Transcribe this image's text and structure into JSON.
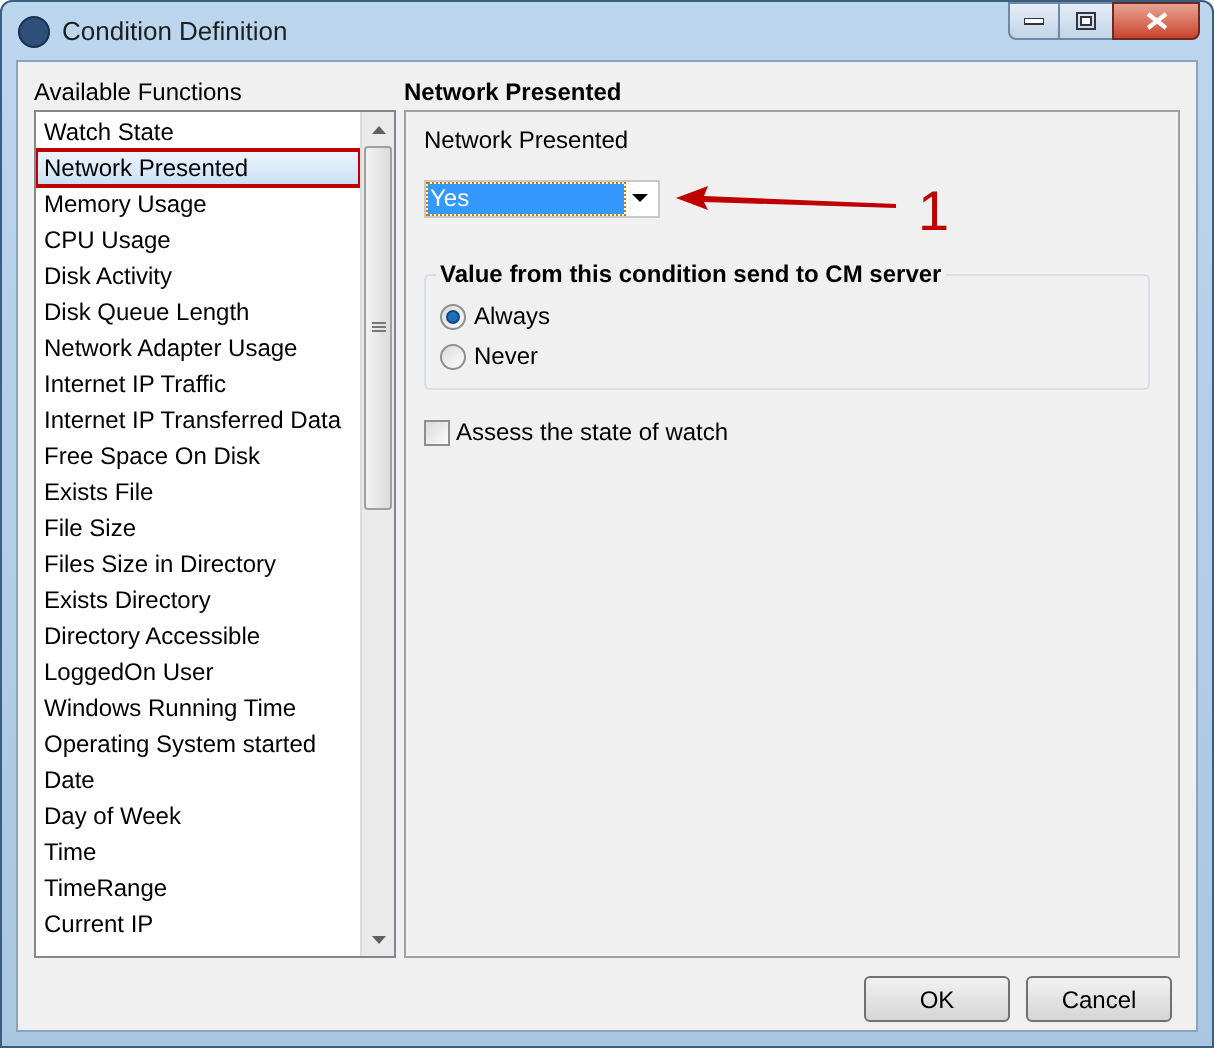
{
  "window": {
    "title": "Condition Definition"
  },
  "functions": {
    "label": "Available Functions",
    "items": [
      {
        "label": "Watch State",
        "selected": false
      },
      {
        "label": "Network Presented",
        "selected": true
      },
      {
        "label": "Memory Usage",
        "selected": false
      },
      {
        "label": "CPU Usage",
        "selected": false
      },
      {
        "label": "Disk Activity",
        "selected": false
      },
      {
        "label": "Disk Queue Length",
        "selected": false
      },
      {
        "label": "Network Adapter Usage",
        "selected": false
      },
      {
        "label": "Internet IP Traffic",
        "selected": false
      },
      {
        "label": "Internet IP Transferred Data",
        "selected": false
      },
      {
        "label": "Free Space On Disk",
        "selected": false
      },
      {
        "label": "Exists File",
        "selected": false
      },
      {
        "label": "File Size",
        "selected": false
      },
      {
        "label": "Files Size in Directory",
        "selected": false
      },
      {
        "label": "Exists Directory",
        "selected": false
      },
      {
        "label": "Directory Accessible",
        "selected": false
      },
      {
        "label": "LoggedOn User",
        "selected": false
      },
      {
        "label": "Windows Running Time",
        "selected": false
      },
      {
        "label": "Operating System started",
        "selected": false
      },
      {
        "label": "Date",
        "selected": false
      },
      {
        "label": "Day of Week",
        "selected": false
      },
      {
        "label": "Time",
        "selected": false
      },
      {
        "label": "TimeRange",
        "selected": false
      },
      {
        "label": "Current IP",
        "selected": false
      }
    ]
  },
  "detail": {
    "title": "Network Presented",
    "field_label": "Network Presented",
    "dropdown_value": "Yes",
    "group": {
      "title": "Value from this condition send to CM server",
      "options": [
        {
          "label": "Always",
          "selected": true
        },
        {
          "label": "Never",
          "selected": false
        }
      ]
    },
    "checkbox": {
      "label": "Assess the state of watch",
      "checked": false
    }
  },
  "annotation": {
    "label": "1"
  },
  "buttons": [
    "OK",
    "Cancel"
  ]
}
